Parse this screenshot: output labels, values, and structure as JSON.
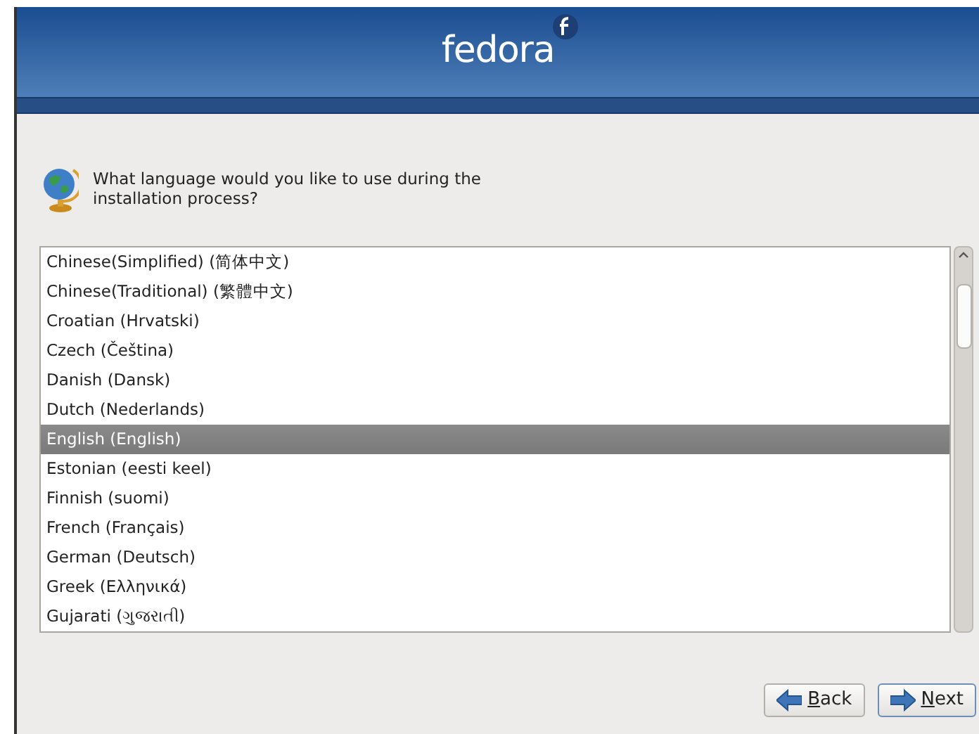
{
  "header": {
    "logo": "fedora"
  },
  "prompt": "What language would you like to use during the installation process?",
  "languages": [
    {
      "label": "Chinese(Simplified) (简体中文)",
      "selected": false
    },
    {
      "label": "Chinese(Traditional) (繁體中文)",
      "selected": false
    },
    {
      "label": "Croatian (Hrvatski)",
      "selected": false
    },
    {
      "label": "Czech (Čeština)",
      "selected": false
    },
    {
      "label": "Danish (Dansk)",
      "selected": false
    },
    {
      "label": "Dutch (Nederlands)",
      "selected": false
    },
    {
      "label": "English (English)",
      "selected": true
    },
    {
      "label": "Estonian (eesti keel)",
      "selected": false
    },
    {
      "label": "Finnish (suomi)",
      "selected": false
    },
    {
      "label": "French (Français)",
      "selected": false
    },
    {
      "label": "German (Deutsch)",
      "selected": false
    },
    {
      "label": "Greek (Ελληνικά)",
      "selected": false
    },
    {
      "label": "Gujarati (ગુજરાતી)",
      "selected": false
    }
  ],
  "buttons": [
    {
      "kind": "back",
      "label": "Back",
      "mnemonic_underlined": true
    },
    {
      "kind": "next",
      "label": "Next",
      "mnemonic_underlined": true
    }
  ]
}
